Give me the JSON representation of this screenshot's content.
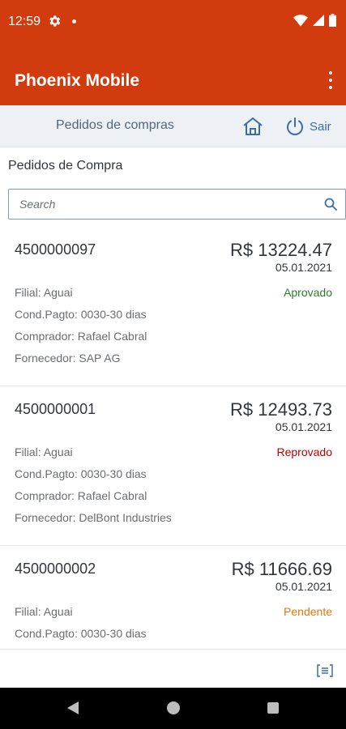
{
  "status_bar": {
    "time": "12:59"
  },
  "app_bar": {
    "title": "Phoenix Mobile"
  },
  "shell": {
    "title": "Pedidos de compras",
    "logout_label": "Sair"
  },
  "page": {
    "heading": "Pedidos de Compra"
  },
  "search": {
    "placeholder": "Search",
    "value": ""
  },
  "colors": {
    "brand": "#d13b0d",
    "shell_bg": "#edf1f5",
    "approved": "#2b7d2b",
    "rejected": "#bb0000",
    "pending": "#e9730c",
    "link": "#3b6ea8"
  },
  "orders": [
    {
      "number": "4500000097",
      "amount": "R$ 13224.47",
      "date": "05.01.2021",
      "status": "Aprovado",
      "status_color": "#2b7d2b",
      "filial": "Filial: Aguai",
      "cond_pagto": "Cond.Pagto: 0030-30 dias",
      "comprador": "Comprador: Rafael Cabral",
      "fornecedor": "Fornecedor: SAP AG"
    },
    {
      "number": "4500000001",
      "amount": "R$ 12493.73",
      "date": "05.01.2021",
      "status": "Reprovado",
      "status_color": "#bb0000",
      "filial": "Filial: Aguai",
      "cond_pagto": "Cond.Pagto: 0030-30 dias",
      "comprador": "Comprador: Rafael Cabral",
      "fornecedor": "Fornecedor: DelBont Industries"
    },
    {
      "number": "4500000002",
      "amount": "R$ 11666.69",
      "date": "05.01.2021",
      "status": "Pendente",
      "status_color": "#e9730c",
      "filial": "Filial: Aguai",
      "cond_pagto": "Cond.Pagto: 0030-30 dias",
      "comprador": "",
      "fornecedor": ""
    }
  ],
  "icons": {
    "status_left": [
      "gear-icon",
      "notification-dot-icon"
    ],
    "status_right": [
      "wifi-icon",
      "signal-icon",
      "battery-icon"
    ],
    "overflow": "more-vertical-icon",
    "home": "home-icon",
    "logout": "power-icon",
    "search": "search-icon",
    "footer": "list-view-icon",
    "nav": [
      "back-icon",
      "home-circle-icon",
      "recents-icon"
    ]
  }
}
